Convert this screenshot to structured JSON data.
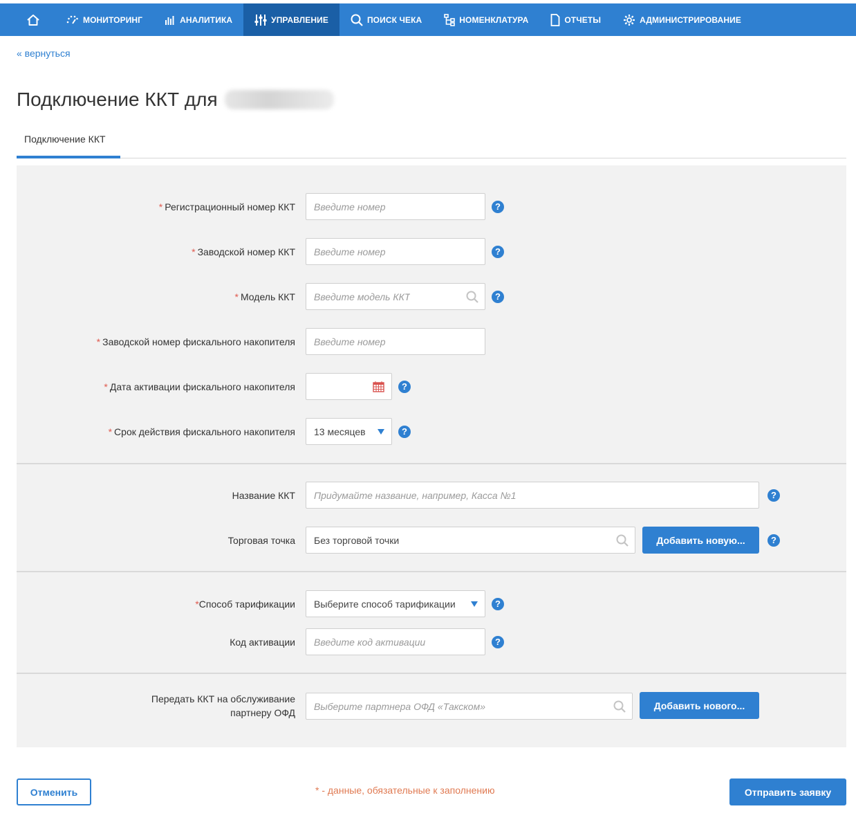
{
  "nav": {
    "items": [
      {
        "label": "МОНИТОРИНГ"
      },
      {
        "label": "АНАЛИТИКА"
      },
      {
        "label": "УПРАВЛЕНИЕ"
      },
      {
        "label": "ПОИСК ЧЕКА"
      },
      {
        "label": "НОМЕНКЛАТУРА"
      },
      {
        "label": "ОТЧЕТЫ"
      },
      {
        "label": "АДМИНИСТРИРОВАНИЕ"
      }
    ],
    "active_index": 2
  },
  "back_link": "« вернуться",
  "page_title": "Подключение ККТ для",
  "tabs": [
    {
      "label": "Подключение ККТ"
    }
  ],
  "required_mark": "*",
  "fields": {
    "reg_number": {
      "label": "Регистрационный номер ККТ",
      "placeholder": "Введите номер"
    },
    "serial_number": {
      "label": "Заводской номер ККТ",
      "placeholder": "Введите номер"
    },
    "model": {
      "label": "Модель ККТ",
      "placeholder": "Введите модель ККТ"
    },
    "fn_serial": {
      "label": "Заводской номер фискального накопителя",
      "placeholder": "Введите номер"
    },
    "fn_activation_date": {
      "label": "Дата активации фискального накопителя",
      "value": ""
    },
    "fn_term": {
      "label": "Срок действия фискального накопителя",
      "value": "13 месяцев"
    },
    "kkt_name": {
      "label": "Название ККТ",
      "placeholder": "Придумайте название, например, Касса №1"
    },
    "outlet": {
      "label": "Торговая точка",
      "value": "Без торговой точки"
    },
    "tariff": {
      "label": "Способ тарификации",
      "value": "Выберите способ тарификации"
    },
    "activation_code": {
      "label": "Код активации",
      "placeholder": "Введите код активации"
    },
    "partner": {
      "label_line1": "Передать ККТ на обслуживание",
      "label_line2": "партнеру ОФД",
      "placeholder": "Выберите партнера ОФД «Такском»"
    }
  },
  "buttons": {
    "add_outlet": "Добавить новую...",
    "add_partner": "Добавить нового...",
    "cancel": "Отменить",
    "submit": "Отправить заявку"
  },
  "help_glyph": "?",
  "footnote": "* - данные, обязательные к заполнению",
  "colors": {
    "nav_bg": "#2f80d1",
    "nav_active": "#1a5fa6",
    "accent": "#2f80d1",
    "required": "#e05a4f",
    "calendar": "#d9534f"
  }
}
